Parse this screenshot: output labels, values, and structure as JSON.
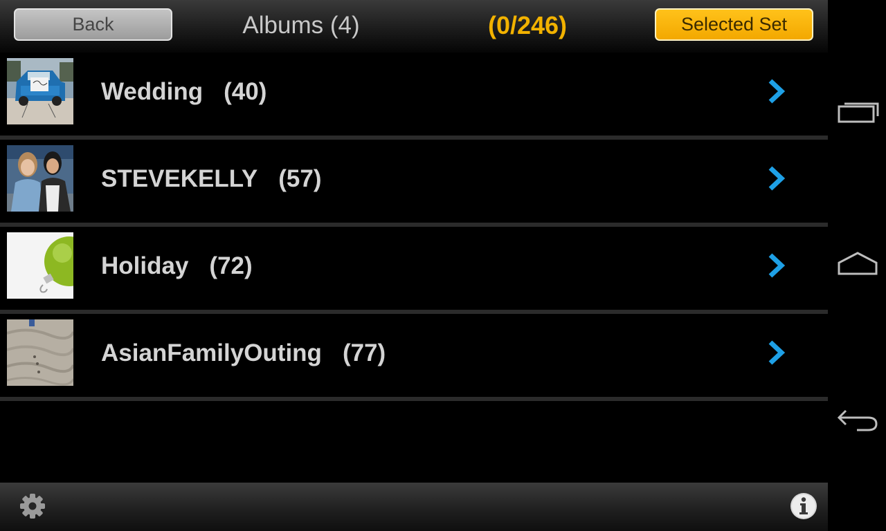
{
  "header": {
    "back_label": "Back",
    "title": "Albums (4)",
    "counter": "(0/246)",
    "selected_set_label": "Selected Set"
  },
  "albums": [
    {
      "name": "Wedding",
      "count": "(40)",
      "thumbnail": "blue-truck-photo"
    },
    {
      "name": "STEVEKELLY",
      "count": "(57)",
      "thumbnail": "two-friends-photo"
    },
    {
      "name": "Holiday",
      "count": "(72)",
      "thumbnail": "green-ornament-photo"
    },
    {
      "name": "AsianFamilyOuting",
      "count": "(77)",
      "thumbnail": "sand-footprints-photo"
    }
  ],
  "footer": {
    "settings_icon": "gear-icon",
    "info_icon": "info-icon"
  },
  "system_nav": {
    "recents_icon": "recent-apps-icon",
    "home_icon": "home-icon",
    "back_icon": "back-arrow-icon"
  },
  "colors": {
    "accent": "#f2b200",
    "chevron": "#1ea0e6",
    "divider": "#2b2b2b",
    "background": "#000000"
  }
}
